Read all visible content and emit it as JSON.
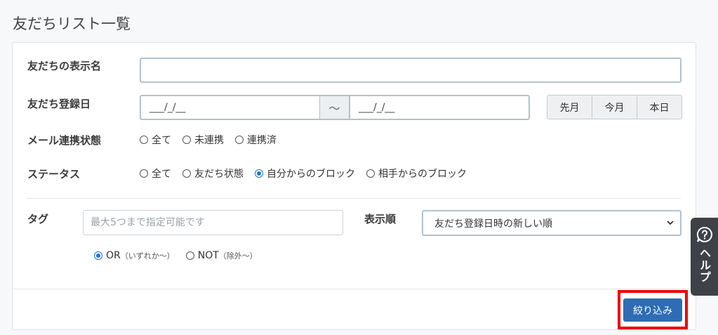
{
  "page": {
    "title": "友だちリスト一覧"
  },
  "form": {
    "display_name": {
      "label": "友だちの表示名",
      "value": "",
      "placeholder": ""
    },
    "registration_date": {
      "label": "友だち登録日",
      "from_value": "___/_/__",
      "separator": "～",
      "to_value": "___/_/__",
      "quick_buttons": [
        "先月",
        "今月",
        "本日"
      ]
    },
    "mail_link_status": {
      "label": "メール連携状態",
      "options": [
        "全て",
        "未連携",
        "連携済"
      ],
      "selected": null
    },
    "status": {
      "label": "ステータス",
      "options": [
        "全て",
        "友だち状態",
        "自分からのブロック",
        "相手からのブロック"
      ],
      "selected": "自分からのブロック"
    },
    "tag": {
      "label": "タグ",
      "placeholder": "最大5つまで指定可能です",
      "mode_options": [
        {
          "label": "OR",
          "note": "（いずれか～）"
        },
        {
          "label": "NOT",
          "note": "（除外～）"
        }
      ],
      "mode_selected": "OR"
    },
    "sort": {
      "label": "表示順",
      "selected": "友だち登録日時の新しい順"
    },
    "submit_label": "絞り込み"
  },
  "help_tab": {
    "label": "ヘルプ",
    "icon": "question-icon"
  },
  "colors": {
    "accent": "#2e6db4",
    "radio_selected": "#1a73d9",
    "highlight": "#ee0000"
  }
}
